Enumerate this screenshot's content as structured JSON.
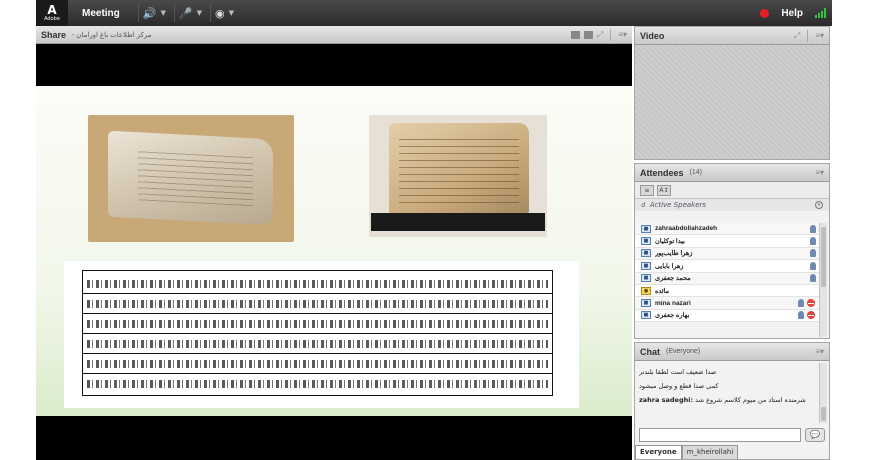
{
  "topbar": {
    "logo": "Adobe",
    "menus": [
      {
        "label": "Meeting"
      }
    ],
    "speaker_icon": "speaker-icon",
    "mic_icon": "microphone-icon",
    "camera_icon": "webcam-icon",
    "help_label": "Help",
    "status_color": "#e31e24",
    "signal_color": "#38c23f"
  },
  "share": {
    "title": "Share",
    "subtitle": "- مرکز اطلاعات باغ اورامان"
  },
  "video": {
    "title": "Video"
  },
  "attendees": {
    "title": "Attendees",
    "count": "(14)",
    "active_speakers_label": "Active Speakers",
    "list": [
      {
        "name": "zahraabdollahzadeh",
        "role": "participant",
        "mic": true,
        "blocked": false
      },
      {
        "name": "بیدا توکلیان",
        "role": "participant",
        "mic": true,
        "blocked": false
      },
      {
        "name": "زهرا طایب‌پور",
        "role": "participant",
        "mic": true,
        "blocked": false
      },
      {
        "name": "زهرا بابایی",
        "role": "participant",
        "mic": true,
        "blocked": false
      },
      {
        "name": "محمد جعفری",
        "role": "participant",
        "mic": true,
        "blocked": false
      },
      {
        "name": "مائده",
        "role": "host",
        "mic": false,
        "blocked": false
      },
      {
        "name": "mina nazari",
        "role": "participant",
        "mic": true,
        "blocked": true
      },
      {
        "name": "بهاره جعفری",
        "role": "participant",
        "mic": true,
        "blocked": true
      }
    ]
  },
  "chat": {
    "title": "Chat",
    "scope": "(Everyone)",
    "messages": [
      {
        "sender": "",
        "text": "صدا ضعیف است لطفا بلندتر"
      },
      {
        "sender": "",
        "text": "کمی صدا قطع و وصل میشود"
      },
      {
        "sender": "zahra sadeghi:",
        "text": "شرمنده استاد من میوم کلاسم شروع شد"
      }
    ],
    "input_value": "",
    "tabs": [
      "Everyone",
      "m_kheirollahi"
    ],
    "send_icon": "speech-bubble-icon"
  }
}
